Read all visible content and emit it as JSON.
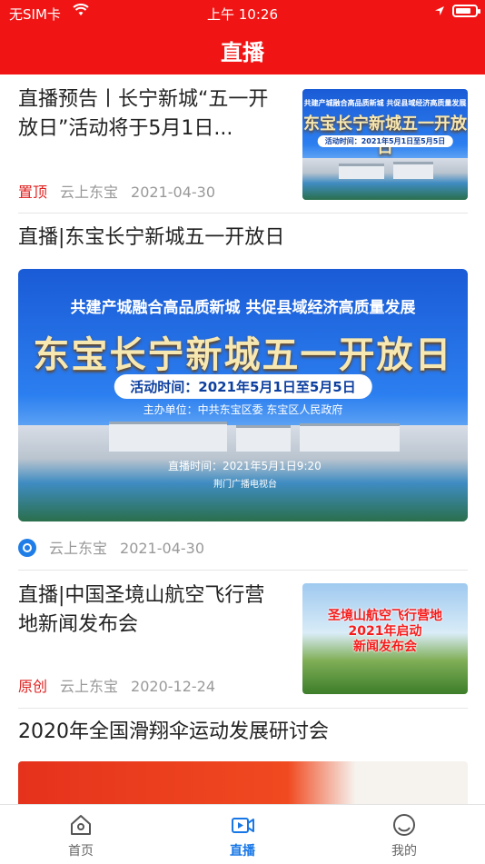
{
  "status_bar": {
    "carrier": "无SIM卡",
    "time": "上午 10:26"
  },
  "nav": {
    "title": "直播"
  },
  "feed": [
    {
      "title": "直播预告丨长宁新城“五一开放日”活动将于5月1日...",
      "tag": "置顶",
      "source": "云上东宝",
      "date": "2021-04-30",
      "thumb": {
        "line1": "共建产城融合高品质新城  共促县域经济高质量发展",
        "headline": "东宝长宁新城五一开放日",
        "pill": "活动时间：2021年5月1日至5月5日"
      }
    },
    {
      "title": "直播|东宝长宁新城五一开放日",
      "source": "云上东宝",
      "date": "2021-04-30",
      "banner": {
        "line1": "共建产城融合高品质新城    共促县域经济高质量发展",
        "headline": "东宝长宁新城五一开放日",
        "pill": "活动时间：2021年5月1日至5月5日",
        "host": "主办单位：中共东宝区委    东宝区人民政府",
        "livetime": "直播时间：2021年5月1日9:20",
        "station": "荆门广播电视台"
      }
    },
    {
      "title": "直播|中国圣境山航空飞行营地新闻发布会",
      "tag": "原创",
      "source": "云上东宝",
      "date": "2020-12-24",
      "thumb": {
        "line1": "圣境山航空飞行营地",
        "line2": "2021年启动",
        "line3": "新闻发布会"
      }
    },
    {
      "title": "2020年全国滑翔伞运动发展研讨会"
    }
  ],
  "tabs": [
    {
      "label": "首页",
      "icon": "home-icon"
    },
    {
      "label": "直播",
      "icon": "live-video-icon",
      "active": true
    },
    {
      "label": "我的",
      "icon": "profile-icon"
    }
  ],
  "colors": {
    "brand_red": "#f01414",
    "active_tab": "#1877e6",
    "tag_red": "#e02020"
  }
}
